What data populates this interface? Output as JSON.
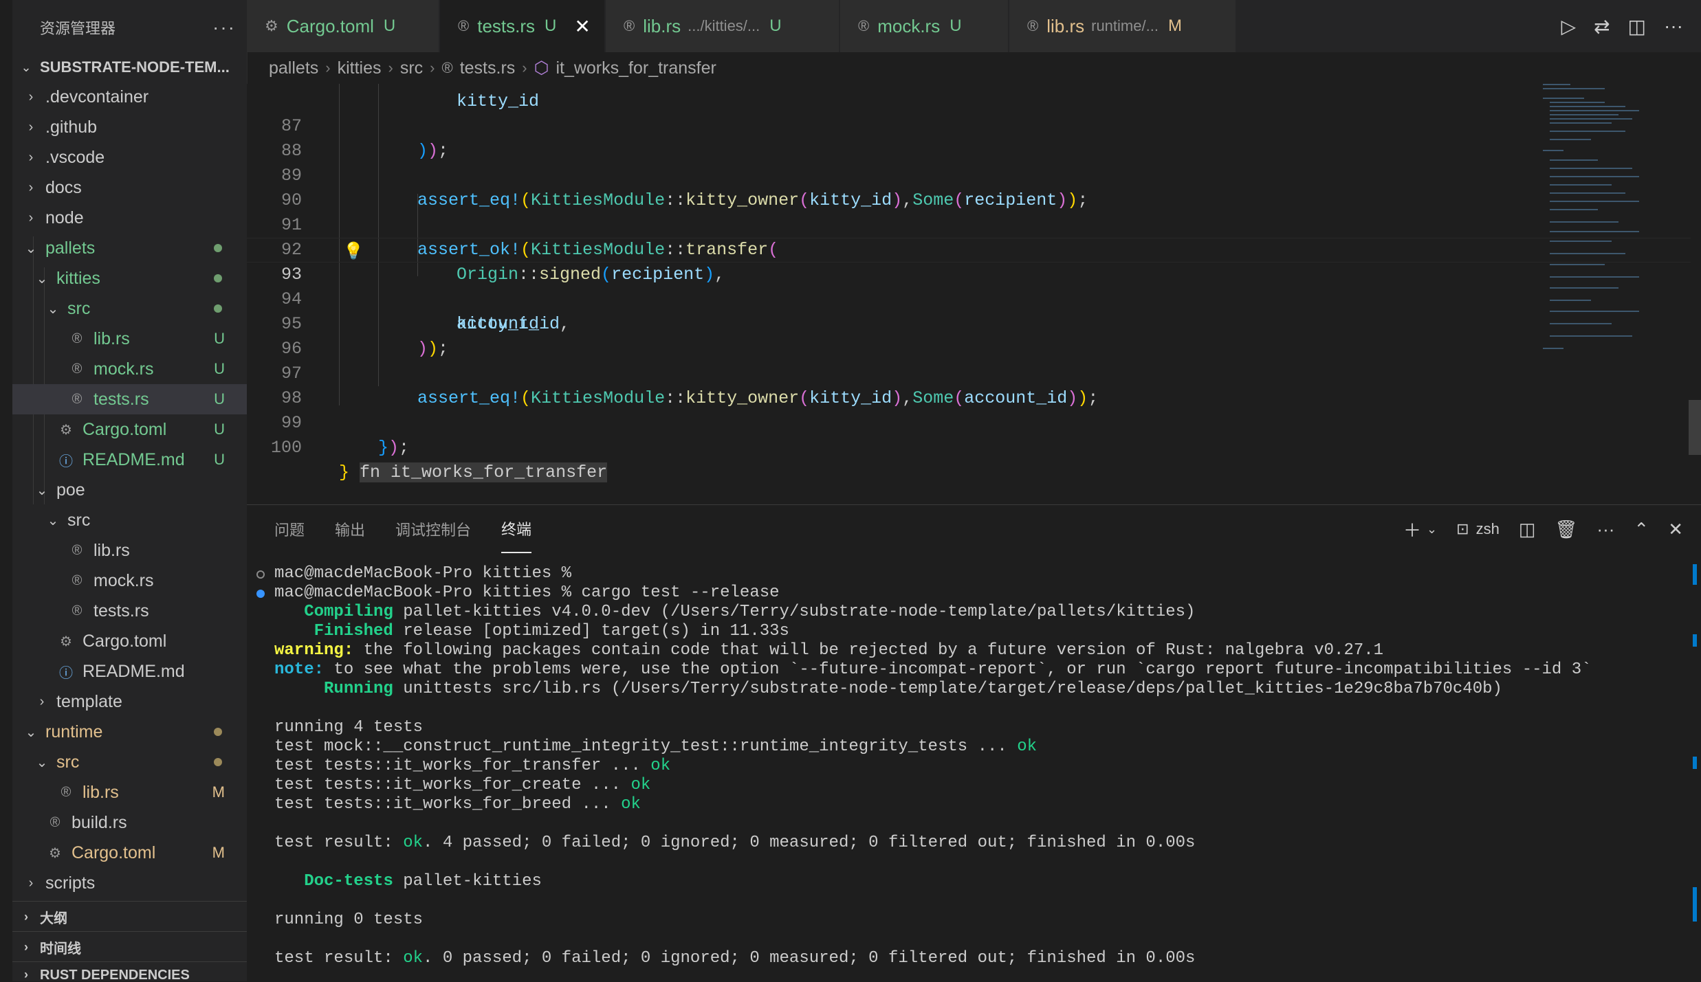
{
  "colors": {
    "untracked": "#73c991",
    "modified": "#e2c08d",
    "accent": "#007acc",
    "editor_bg": "#1e1e1e"
  },
  "sidebar": {
    "title": "资源管理器",
    "more": "···",
    "workspace": "SUBSTRATE-NODE-TEM...",
    "items": [
      {
        "label": ".devcontainer",
        "badge": ""
      },
      {
        "label": ".github",
        "badge": ""
      },
      {
        "label": ".vscode",
        "badge": ""
      },
      {
        "label": "docs",
        "badge": ""
      },
      {
        "label": "node",
        "badge": ""
      },
      {
        "label": "pallets",
        "badge": ""
      },
      {
        "label": "kitties",
        "badge": ""
      },
      {
        "label": "src",
        "badge": ""
      },
      {
        "label": "lib.rs",
        "badge": "U"
      },
      {
        "label": "mock.rs",
        "badge": "U"
      },
      {
        "label": "tests.rs",
        "badge": "U"
      },
      {
        "label": "Cargo.toml",
        "badge": "U"
      },
      {
        "label": "README.md",
        "badge": "U"
      },
      {
        "label": "poe",
        "badge": ""
      },
      {
        "label": "src",
        "badge": ""
      },
      {
        "label": "lib.rs",
        "badge": ""
      },
      {
        "label": "mock.rs",
        "badge": ""
      },
      {
        "label": "tests.rs",
        "badge": ""
      },
      {
        "label": "Cargo.toml",
        "badge": ""
      },
      {
        "label": "README.md",
        "badge": ""
      },
      {
        "label": "template",
        "badge": ""
      },
      {
        "label": "runtime",
        "badge": ""
      },
      {
        "label": "src",
        "badge": ""
      },
      {
        "label": "lib.rs",
        "badge": "M"
      },
      {
        "label": "build.rs",
        "badge": ""
      },
      {
        "label": "Cargo.toml",
        "badge": "M"
      },
      {
        "label": "scripts",
        "badge": ""
      }
    ],
    "sections": [
      "大纲",
      "时间线",
      "RUST DEPENDENCIES"
    ]
  },
  "tabs": [
    {
      "label": "Cargo.toml",
      "desc": "",
      "badge": "U"
    },
    {
      "label": "tests.rs",
      "desc": "",
      "badge": "U",
      "close": "✕"
    },
    {
      "label": "lib.rs",
      "desc": ".../kitties/...",
      "badge": "U"
    },
    {
      "label": "mock.rs",
      "desc": "",
      "badge": "U"
    },
    {
      "label": "lib.rs",
      "desc": "runtime/...",
      "badge": "M"
    }
  ],
  "breadcrumb": [
    "pallets",
    "kitties",
    "src",
    "tests.rs",
    "it_works_for_transfer"
  ],
  "editor": {
    "line_numbers": [
      "87",
      "88",
      "89",
      "90",
      "91",
      "92",
      "93",
      "94",
      "95",
      "96",
      "97",
      "98",
      "99",
      "100"
    ],
    "current_line": "93",
    "closing_hint": "fn it_works_for_transfer"
  },
  "panel": {
    "tabs": [
      "问题",
      "输出",
      "调试控制台",
      "终端"
    ],
    "shell": "zsh"
  },
  "terminal": {
    "prompt1": "mac@macdeMacBook-Pro kitties %",
    "prompt2": "mac@macdeMacBook-Pro kitties % cargo test --release",
    "compiling_kw": "Compiling",
    "compiling_text": " pallet-kitties v4.0.0-dev (/Users/Terry/substrate-node-template/pallets/kitties)",
    "finished_kw": "Finished",
    "finished_text": " release [optimized] target(s) in 11.33s",
    "warning_kw": "warning:",
    "warning_text": " the following packages contain code that will be rejected by a future version of Rust: nalgebra v0.27.1",
    "note_kw": "note:",
    "note_text": " to see what the problems were, use the option `--future-incompat-report`, or run `cargo report future-incompatibilities --id 3`",
    "running_kw": "Running",
    "running_text": " unittests src/lib.rs (/Users/Terry/substrate-node-template/target/release/deps/pallet_kitties-1e29c8ba7b70c40b)",
    "running4": "running 4 tests",
    "tests": [
      {
        "name": "test mock::__construct_runtime_integrity_test::runtime_integrity_tests ... ",
        "status": "ok"
      },
      {
        "name": "test tests::it_works_for_transfer ... ",
        "status": "ok"
      },
      {
        "name": "test tests::it_works_for_create ... ",
        "status": "ok"
      },
      {
        "name": "test tests::it_works_for_breed ... ",
        "status": "ok"
      }
    ],
    "result_prefix": "test result: ",
    "result_ok": "ok",
    "result1_rest": ". 4 passed; 0 failed; 0 ignored; 0 measured; 0 filtered out; finished in 0.00s",
    "doctests_kw": "Doc-tests",
    "doctests_text": " pallet-kitties",
    "running0": "running 0 tests",
    "result2_rest": ". 0 passed; 0 failed; 0 ignored; 0 measured; 0 filtered out; finished in 0.00s"
  }
}
